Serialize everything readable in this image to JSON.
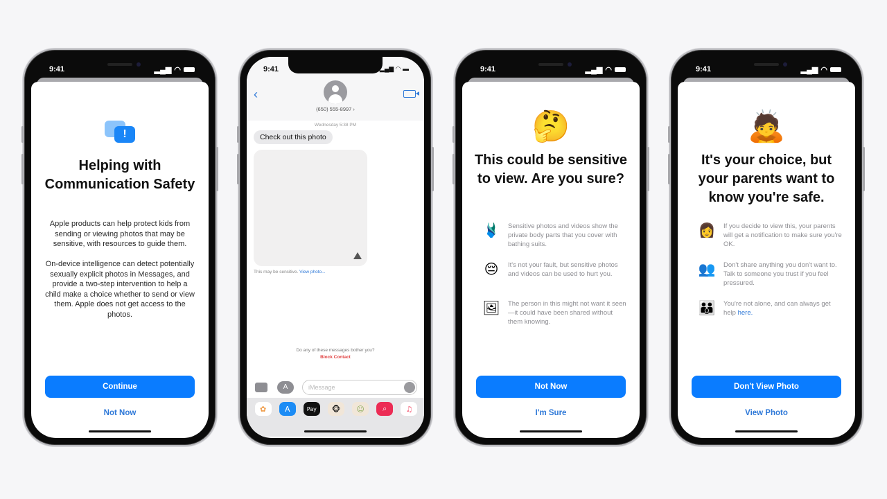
{
  "status_time": "9:41",
  "phones": [
    {
      "icon": "chat-warning-icon",
      "title": "Helping with Communication Safety",
      "paragraphs": [
        "Apple products can help protect kids from sending or viewing photos that may be sensitive, with resources to guide them.",
        "On-device intelligence can detect potentially sexually explicit photos in Messages, and provide a two-step intervention to help a child make a choice whether to send or view them. Apple does not get access to the photos."
      ],
      "primary_button": "Continue",
      "secondary_button": "Not Now"
    },
    {
      "contact": "(650) 555-8997 ›",
      "timestamp": "Wednesday 5:38 PM",
      "message": "Check out this photo",
      "sensitive_note": "This may be sensitive.",
      "view_link": "View photo...",
      "bother_prompt": "Do any of these messages bother you?",
      "block_link": "Block Contact",
      "input_placeholder": "iMessage",
      "app_strip": [
        {
          "name": "photos-app-icon",
          "glyph": "✿",
          "color": "#ffffff",
          "fg": "#e94"
        },
        {
          "name": "app-store-icon",
          "glyph": "A",
          "color": "#1c8cf5",
          "fg": "#fff"
        },
        {
          "name": "apple-pay-icon",
          "glyph": "Pay",
          "color": "#111111",
          "fg": "#fff"
        },
        {
          "name": "memoji-monkey-icon",
          "glyph": "🐵",
          "color": "#f1e6d8",
          "fg": "#000"
        },
        {
          "name": "memoji-icon",
          "glyph": "☺",
          "color": "#f1e6d8",
          "fg": "#8a5"
        },
        {
          "name": "search-images-icon",
          "glyph": "⌕",
          "color": "#ec2c55",
          "fg": "#fff"
        },
        {
          "name": "music-icon",
          "glyph": "♫",
          "color": "#ffffff",
          "fg": "#f2506b"
        }
      ]
    },
    {
      "emoji": "🤔",
      "title": "This could be sensitive to view. Are you sure?",
      "rows": [
        {
          "icon": "swimsuit-icon",
          "glyph": "🩱",
          "text": "Sensitive photos and videos show the private body parts that you cover with bathing suits."
        },
        {
          "icon": "pensive-face-icon",
          "glyph": "😔",
          "text": "It's not your fault, but sensitive photos and videos can be used to hurt you."
        },
        {
          "icon": "picture-faces-icon",
          "glyph": "🖼",
          "text": "The person in this might not want it seen—it could have been shared without them knowing."
        }
      ],
      "primary_button": "Not Now",
      "secondary_button": "I'm Sure"
    },
    {
      "emoji": "🙇",
      "title": "It's your choice, but your parents want to know you're safe.",
      "rows": [
        {
          "icon": "parent-notification-icon",
          "glyph": "👩",
          "text": "If you decide to view this, your parents will get a notification to make sure you're OK."
        },
        {
          "icon": "trust-people-icon",
          "glyph": "👥",
          "text": "Don't share anything you don't want to. Talk to someone you trust if you feel pressured."
        },
        {
          "icon": "family-icon",
          "glyph": "👪",
          "text": "You're not alone, and can always get help",
          "link": "here."
        }
      ],
      "primary_button": "Don't View Photo",
      "secondary_button": "View Photo"
    }
  ]
}
